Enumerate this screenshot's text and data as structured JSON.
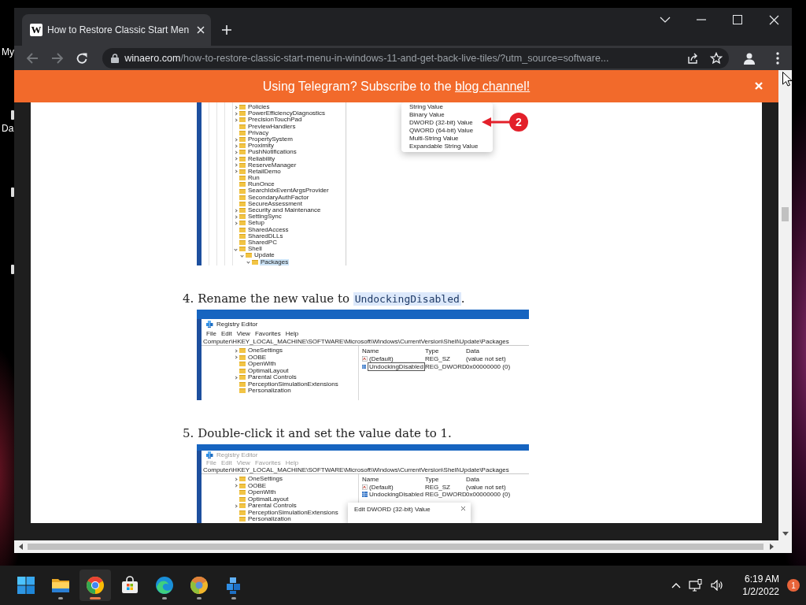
{
  "desktop": {
    "icons": [
      {
        "label": "My"
      },
      {
        "label": "Da"
      }
    ]
  },
  "browser": {
    "tabs": [
      {
        "favicon": "W",
        "title": "How to Restore Classic Start Men",
        "selected": true
      }
    ],
    "back": {
      "disabled": true
    },
    "forward": {
      "disabled": true
    },
    "address": {
      "domain": "winaero.com",
      "path": "/how-to-restore-classic-start-menu-in-windows-11-and-get-back-live-tiles/?utm_source=software..."
    },
    "banner": {
      "text": "Using Telegram? Subscribe to the ",
      "link": "blog channel!"
    }
  },
  "article": [
    {
      "kind": "regedit_fragment",
      "tree": [
        {
          "label": "Policies",
          "expandable": true,
          "expanded": false,
          "selected": false
        },
        {
          "label": "PowerEfficiencyDiagnostics",
          "expandable": true,
          "expanded": false,
          "selected": false
        },
        {
          "label": "PrecisionTouchPad",
          "expandable": true,
          "expanded": false,
          "selected": false
        },
        {
          "label": "PreviewHandlers",
          "expandable": false,
          "selected": false
        },
        {
          "label": "Privacy",
          "expandable": false,
          "selected": false
        },
        {
          "label": "PropertySystem",
          "expandable": true,
          "expanded": false,
          "selected": false
        },
        {
          "label": "Proximity",
          "expandable": true,
          "expanded": false,
          "selected": false
        },
        {
          "label": "PushNotifications",
          "expandable": true,
          "expanded": false,
          "selected": false
        },
        {
          "label": "Reliability",
          "expandable": true,
          "expanded": false,
          "selected": false
        },
        {
          "label": "ReserveManager",
          "expandable": true,
          "expanded": false,
          "selected": false
        },
        {
          "label": "RetailDemo",
          "expandable": true,
          "expanded": false,
          "selected": false
        },
        {
          "label": "Run",
          "expandable": false,
          "selected": false
        },
        {
          "label": "RunOnce",
          "expandable": false,
          "selected": false
        },
        {
          "label": "SearchIdxEventArgsProvider",
          "expandable": false,
          "selected": false
        },
        {
          "label": "SecondaryAuthFactor",
          "expandable": false,
          "selected": false
        },
        {
          "label": "SecureAssessment",
          "expandable": false,
          "selected": false
        },
        {
          "label": "Security and Maintenance",
          "expandable": true,
          "expanded": false,
          "selected": false
        },
        {
          "label": "SettingSync",
          "expandable": true,
          "expanded": false,
          "selected": false
        },
        {
          "label": "Setup",
          "expandable": true,
          "expanded": false,
          "selected": false
        },
        {
          "label": "SharedAccess",
          "expandable": false,
          "selected": false
        },
        {
          "label": "SharedDLLs",
          "expandable": false,
          "selected": false
        },
        {
          "label": "SharedPC",
          "expandable": false,
          "selected": false
        },
        {
          "label": "Shell",
          "expandable": true,
          "expanded": true,
          "selected": false,
          "children": [
            {
              "label": "Update",
              "expandable": true,
              "expanded": true,
              "selected": false,
              "children": [
                {
                  "label": "Packages",
                  "expandable": true,
                  "expanded": true,
                  "selected": true
                }
              ]
            }
          ]
        }
      ],
      "menu": [
        {
          "label": "String Value"
        },
        {
          "label": "Binary Value"
        },
        {
          "label": "DWORD (32-bit) Value",
          "callout": "2"
        },
        {
          "label": "QWORD (64-bit) Value"
        },
        {
          "label": "Multi-String Value"
        },
        {
          "label": "Expandable String Value"
        }
      ]
    },
    {
      "kind": "step",
      "number": "4.",
      "text": "Rename the new value to ",
      "code": "UndockingDisabled",
      "after": "."
    },
    {
      "kind": "regedit_window",
      "active": true,
      "title": "Registry Editor",
      "menu": [
        "File",
        "Edit",
        "View",
        "Favorites",
        "Help"
      ],
      "path": "Computer\\HKEY_LOCAL_MACHINE\\SOFTWARE\\Microsoft\\Windows\\CurrentVersion\\Shell\\Update\\Packages",
      "tree": [
        {
          "label": "OneSettings",
          "expandable": true
        },
        {
          "label": "OOBE",
          "expandable": true
        },
        {
          "label": "OpenWith",
          "expandable": false
        },
        {
          "label": "OptimalLayout",
          "expandable": false
        },
        {
          "label": "Parental Controls",
          "expandable": true
        },
        {
          "label": "PerceptionSimulationExtensions",
          "expandable": false
        },
        {
          "label": "Personalization",
          "expandable": false
        }
      ],
      "columns": [
        "Name",
        "Type",
        "Data"
      ],
      "values": [
        {
          "kind": "string",
          "name": "(Default)",
          "type": "REG_SZ",
          "data": "(value not set)",
          "editing": false
        },
        {
          "kind": "dword",
          "name": "UndockingDisabled",
          "type": "REG_DWORD",
          "data": "0x00000000 (0)",
          "editing": true
        }
      ]
    },
    {
      "kind": "step",
      "number": "5.",
      "text": "Double-click it and set the value date to 1."
    },
    {
      "kind": "regedit_window",
      "active": false,
      "title": "Registry Editor",
      "menu": [
        "File",
        "Edit",
        "View",
        "Favorites",
        "Help"
      ],
      "path": "Computer\\HKEY_LOCAL_MACHINE\\SOFTWARE\\Microsoft\\Windows\\CurrentVersion\\Shell\\Update\\Packages",
      "tree": [
        {
          "label": "OneSettings",
          "expandable": true
        },
        {
          "label": "OOBE",
          "expandable": true
        },
        {
          "label": "OpenWith",
          "expandable": false
        },
        {
          "label": "OptimalLayout",
          "expandable": false
        },
        {
          "label": "Parental Controls",
          "expandable": true
        },
        {
          "label": "PerceptionSimulationExtensions",
          "expandable": false
        },
        {
          "label": "Personalization",
          "expandable": false
        }
      ],
      "columns": [
        "Name",
        "Type",
        "Data"
      ],
      "values": [
        {
          "kind": "string",
          "name": "(Default)",
          "type": "REG_SZ",
          "data": "(value not set)",
          "editing": false
        },
        {
          "kind": "dword",
          "name": "UndockingDisabled",
          "type": "REG_DWORD",
          "data": "0x00000000 (0)",
          "editing": false
        }
      ],
      "dialog": {
        "title": "Edit DWORD (32-bit) Value"
      }
    }
  ],
  "taskbar": {
    "apps": [
      {
        "kind": "start",
        "running": false,
        "active": false
      },
      {
        "kind": "explorer",
        "running": true,
        "active": false
      },
      {
        "kind": "chrome",
        "running": true,
        "active": true
      },
      {
        "kind": "store",
        "running": false,
        "active": false
      },
      {
        "kind": "edge",
        "running": true,
        "active": false
      },
      {
        "kind": "orb",
        "running": true,
        "active": false
      },
      {
        "kind": "cubes",
        "running": true,
        "active": false
      }
    ],
    "time": "6:19 AM",
    "date": "1/2/2022",
    "notifications": "1"
  }
}
